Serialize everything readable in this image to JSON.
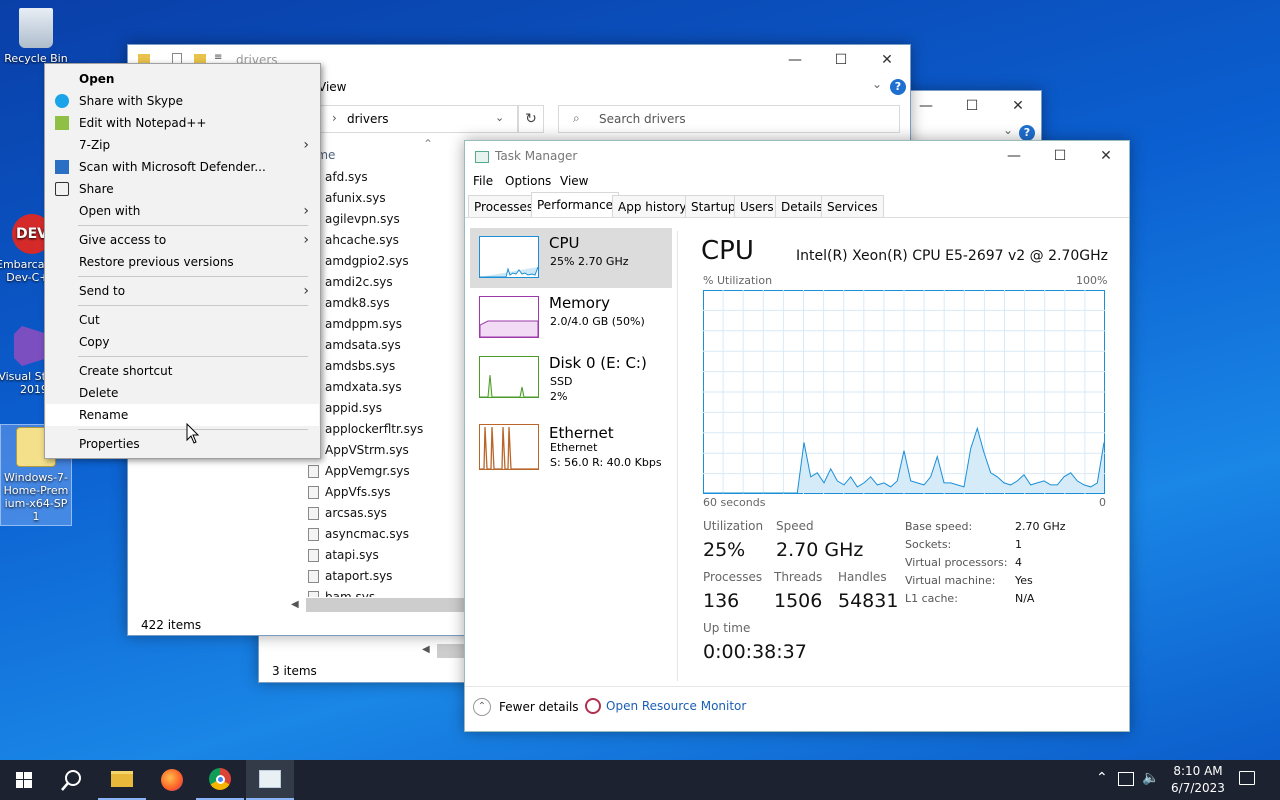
{
  "desktop": {
    "icons": [
      {
        "label": "Recycle Bin"
      },
      {
        "label": "Embarcadero Dev-C++"
      },
      {
        "label": "Visual Studio 2019"
      },
      {
        "label": "Windows-7-Home-Premium-x64-SP1"
      }
    ]
  },
  "explorer_back": {
    "status": "3 items"
  },
  "explorer": {
    "title": "drivers",
    "ribbon_view": "View",
    "path": "drivers",
    "search_placeholder": "Search drivers",
    "column_name": "Name",
    "files": [
      "afd.sys",
      "afunix.sys",
      "agilevpn.sys",
      "ahcache.sys",
      "amdgpio2.sys",
      "amdi2c.sys",
      "amdk8.sys",
      "amdppm.sys",
      "amdsata.sys",
      "amdsbs.sys",
      "amdxata.sys",
      "appid.sys",
      "applockerfltr.sys",
      "AppVStrm.sys",
      "AppVemgr.sys",
      "AppVfs.sys",
      "arcsas.sys",
      "asyncmac.sys",
      "atapi.sys",
      "ataport.sys",
      "bam.sys"
    ],
    "status": "422 items"
  },
  "context_menu": {
    "items": [
      {
        "label": "Open",
        "bold": true
      },
      {
        "label": "Share with Skype",
        "icon": "skype-icon"
      },
      {
        "label": "Edit with Notepad++",
        "icon": "notepadpp-icon"
      },
      {
        "label": "7-Zip",
        "submenu": true
      },
      {
        "label": "Scan with Microsoft Defender...",
        "icon": "defender-icon"
      },
      {
        "label": "Share",
        "icon": "share-icon"
      },
      {
        "label": "Open with",
        "submenu": true
      },
      {
        "label": "Give access to",
        "submenu": true
      },
      {
        "label": "Restore previous versions"
      },
      {
        "label": "Send to",
        "submenu": true
      },
      {
        "label": "Cut"
      },
      {
        "label": "Copy"
      },
      {
        "label": "Create shortcut"
      },
      {
        "label": "Delete"
      },
      {
        "label": "Rename",
        "highlighted": true
      },
      {
        "label": "Properties"
      }
    ]
  },
  "task_manager": {
    "title": "Task Manager",
    "menu": [
      "File",
      "Options",
      "View"
    ],
    "tabs": [
      "Processes",
      "Performance",
      "App history",
      "Startup",
      "Users",
      "Details",
      "Services"
    ],
    "active_tab": "Performance",
    "resources": [
      {
        "name": "CPU",
        "sub1": "25% 2.70 GHz",
        "sub2": "",
        "sub3": "",
        "selected": true
      },
      {
        "name": "Memory",
        "sub1": "2.0/4.0 GB (50%)",
        "sub2": "",
        "sub3": ""
      },
      {
        "name": "Disk 0 (E: C:)",
        "sub1": "SSD",
        "sub2": "2%",
        "sub3": ""
      },
      {
        "name": "Ethernet",
        "sub1": "Ethernet",
        "sub2": "S: 56.0  R: 40.0 Kbps",
        "sub3": ""
      }
    ],
    "cpu": {
      "heading": "CPU",
      "model": "Intel(R) Xeon(R) CPU E5-2697 v2 @ 2.70GHz",
      "util_label": "% Utilization",
      "max_label": "100%",
      "time_label": "60 seconds",
      "zero_label": "0",
      "stats": {
        "utilization_label": "Utilization",
        "utilization": "25%",
        "speed_label": "Speed",
        "speed": "2.70 GHz",
        "processes_label": "Processes",
        "processes": "136",
        "threads_label": "Threads",
        "threads": "1506",
        "handles_label": "Handles",
        "handles": "54831",
        "uptime_label": "Up time",
        "uptime": "0:00:38:37"
      },
      "details": [
        {
          "k": "Base speed:",
          "v": "2.70 GHz"
        },
        {
          "k": "Sockets:",
          "v": "1"
        },
        {
          "k": "Virtual processors:",
          "v": "4"
        },
        {
          "k": "Virtual machine:",
          "v": "Yes"
        },
        {
          "k": "L1 cache:",
          "v": "N/A"
        }
      ]
    },
    "footer": {
      "fewer": "Fewer details",
      "monitor": "Open Resource Monitor"
    }
  },
  "chart_data": {
    "type": "area",
    "title": "CPU",
    "xlabel": "60 seconds",
    "ylabel": "% Utilization",
    "ylim": [
      0,
      100
    ],
    "x": [
      0,
      1,
      2,
      3,
      4,
      5,
      6,
      7,
      8,
      9,
      10,
      11,
      12,
      13,
      14,
      15,
      16,
      17,
      18,
      19,
      20,
      21,
      22,
      23,
      24,
      25,
      26,
      27,
      28,
      29,
      30,
      31,
      32,
      33,
      34,
      35,
      36,
      37,
      38,
      39,
      40,
      41,
      42,
      43,
      44,
      45,
      46,
      47,
      48,
      49,
      50,
      51,
      52,
      53,
      54,
      55,
      56,
      57,
      58,
      59,
      60
    ],
    "series": [
      {
        "values": [
          0,
          0,
          0,
          0,
          0,
          0,
          0,
          0,
          0,
          0,
          0,
          0,
          0,
          0,
          0,
          25,
          8,
          10,
          5,
          12,
          6,
          4,
          8,
          3,
          5,
          8,
          4,
          5,
          3,
          6,
          21,
          6,
          5,
          4,
          8,
          18,
          5,
          5,
          4,
          3,
          22,
          32,
          20,
          10,
          8,
          5,
          4,
          6,
          9,
          4,
          5,
          6,
          4,
          4,
          8,
          10,
          6,
          4,
          3,
          5,
          25
        ]
      }
    ],
    "grid": true
  },
  "taskbar": {
    "time": "8:10 AM",
    "date": "6/7/2023"
  }
}
